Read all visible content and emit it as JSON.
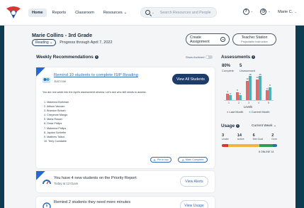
{
  "nav": {
    "items": [
      "Home",
      "Reports",
      "Classroom",
      "Resources"
    ],
    "active": "Home"
  },
  "search": {
    "placeholder": "Search Resources and People"
  },
  "user": {
    "name": "Marie C."
  },
  "header": {
    "title": "Marie Collins - 3rd Grade",
    "subject": "Reading",
    "progress": "Progress through April 7, 2022"
  },
  "buttons": {
    "create_assignment": "Create Assignment",
    "teacher_station": "Teacher Station",
    "teacher_station_sub": "Projectable Instruction"
  },
  "weekly": {
    "title": "Weekly Recommendations",
    "show_archived": "Show Archived"
  },
  "rec1": {
    "title": "Remind 10 students to complete ISIP Reading",
    "time": "Just now",
    "action": "View All Students",
    "description": "You are one week into the April's assessment window. Let's see who still needs to assess.",
    "students": [
      "1. Makenna Bothman",
      "2. Adison Vaccaro",
      "3. Brandon Botosh",
      "4. Cheyenne Mango",
      "5. Maria Rosser",
      "6. Omar Philips",
      "7. Makenna Philips",
      "8. Jaydon Schleifer",
      "9. Matthew Talbot",
      "10. Terry Constable"
    ],
    "pin": "Pin to top",
    "complete": "Mark Complete"
  },
  "rec2": {
    "title": "You have 4 new students on the Priority Report",
    "time": "Today at 12:01am",
    "action": "View Alerts"
  },
  "rec3": {
    "title": "Remind 2 students they need more minutes",
    "action": "View Usage"
  },
  "assessments": {
    "title": "Assessments",
    "complete_value": "80%",
    "complete_label": "Complete",
    "unassessed_value": "5",
    "unassessed_label": "Unassessed",
    "levels_label": "Levels",
    "legend_last": "Last Month",
    "legend_current": "Current Month"
  },
  "chart_data": {
    "type": "bar",
    "categories": [
      "1",
      "2",
      "3",
      "4",
      "5"
    ],
    "series": [
      {
        "name": "Last Month",
        "values": [
          4,
          5,
          12,
          13,
          6
        ]
      },
      {
        "name": "Current Month",
        "values": [
          3,
          3,
          15,
          15,
          8
        ]
      }
    ],
    "xlabel": "Levels",
    "colors": {
      "last": "#e06a6a",
      "current": "#4bb3b8"
    }
  },
  "usage": {
    "title": "Usage",
    "period": "Current Week",
    "stats": [
      {
        "value": "3",
        "label": "Under"
      },
      {
        "value": "14",
        "label": "Active"
      },
      {
        "value": "6",
        "label": "Met Goal"
      },
      {
        "value": "2",
        "label": "Over"
      }
    ],
    "online": "6 ONLINE 14"
  }
}
